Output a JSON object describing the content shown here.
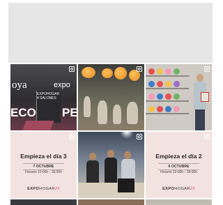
{
  "promo_tiles": [
    {
      "title": "Empieza el día 3",
      "date": "7 OCTUBRE",
      "hours": "Horario 10:00h - 18:00h",
      "logo_a": "EXPO",
      "logo_b": "HOGAR",
      "logo_c": "25"
    },
    {
      "title": "Empieza el día 2",
      "date": "6 OCTUBRE",
      "hours": "Horario 10:00h - 18:00h",
      "logo_a": "EXPO",
      "logo_b": "HOGAR",
      "logo_c": "25"
    }
  ],
  "expo_photo": {
    "word_left": "oya",
    "word_right": "expo",
    "word_eco": "ECO",
    "word_pe": "PE",
    "panel_text": "EXPOHOGAR 4 SALONES"
  },
  "colors": {
    "promo_bg": "#f2e2e0",
    "logo_accent": "#d84b5c",
    "placeholder": "#e6e6e6"
  },
  "icons": {
    "tile_corner": "multiple-images-icon"
  }
}
